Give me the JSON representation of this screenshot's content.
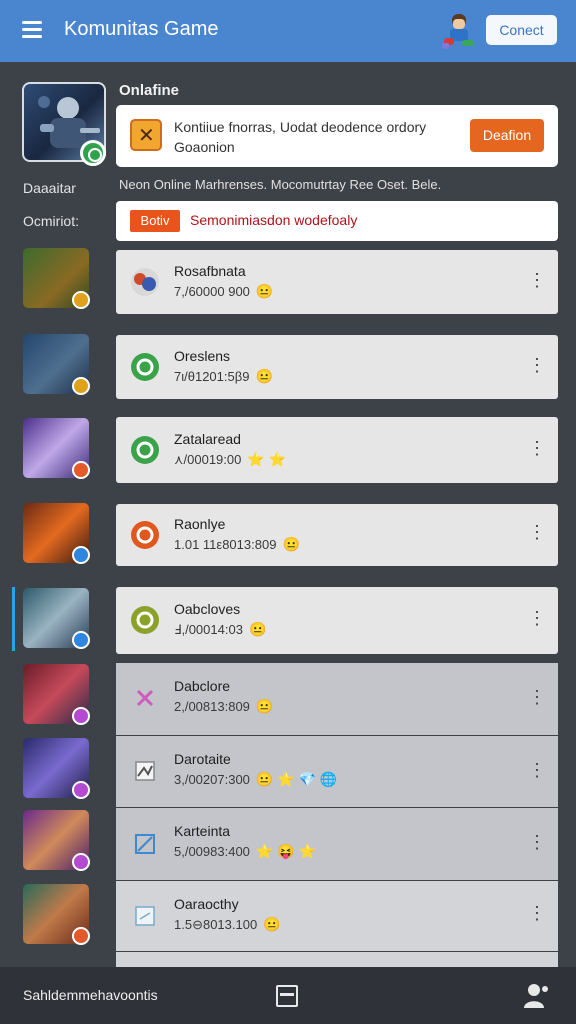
{
  "header": {
    "title": "Komunitas Game",
    "connect_label": "Conect"
  },
  "profile": {
    "section_title": "Onlafine",
    "featured_text": "Kontiiue fnorras, Uodat deodence ordory Goaonion",
    "featured_button": "Deafion",
    "side_label_1": "Daaaitar",
    "side_label_2": "Ocmiriot:",
    "info_line": "Neon Online Marhrenses. Mocomutrtay Ree Oset. Bele.",
    "notice_tag": "Botiv",
    "notice_text": "Semonimiasdon wodefoaly"
  },
  "games": [
    {
      "name": "Rosafbnata",
      "meta": "7,/60000 900",
      "emoji": "😐"
    },
    {
      "name": "Oreslens",
      "meta": "7ι/θ1201:5β9",
      "emoji": "😐"
    },
    {
      "name": "Zatalaread",
      "meta": "⋏/00019:00",
      "emoji": "⭐ ⭐"
    },
    {
      "name": "Raonlye",
      "meta": "1.01 11ε8013:809",
      "emoji": "😐"
    },
    {
      "name": "Oabcloves",
      "meta": "Ⅎ,/00014:03",
      "emoji": "😐"
    },
    {
      "name": "Dabclore",
      "meta": "2,/00813:809",
      "emoji": "😐"
    },
    {
      "name": "Darotaite",
      "meta": "3,/00207:300",
      "emoji": "😐 ⭐ 💎 🌐"
    },
    {
      "name": "Karteinta",
      "meta": "5,/00983:400",
      "emoji": "⭐ 😝 ⭐"
    },
    {
      "name": "Oaraocthy",
      "meta": "1.5⊖8013.100",
      "emoji": "😐"
    }
  ],
  "bottom": {
    "label": "Sahldemmehavoontis"
  }
}
